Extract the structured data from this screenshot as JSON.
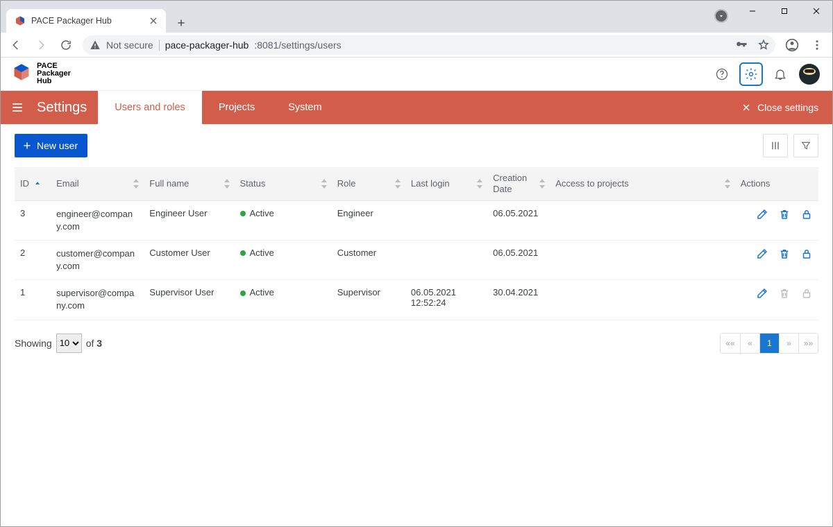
{
  "browser": {
    "tab_title": "PACE Packager Hub",
    "not_secure_label": "Not secure",
    "url_host": "pace-packager-hub",
    "url_port_path": ":8081/settings/users"
  },
  "app": {
    "logo_lines": [
      "PACE",
      "Packager",
      "Hub"
    ]
  },
  "settings_bar": {
    "title": "Settings",
    "tabs": [
      {
        "label": "Users and roles",
        "active": true
      },
      {
        "label": "Projects",
        "active": false
      },
      {
        "label": "System",
        "active": false
      }
    ],
    "close_label": "Close settings"
  },
  "toolbar": {
    "new_user_label": "New user"
  },
  "table": {
    "columns": {
      "id": "ID",
      "email": "Email",
      "full_name": "Full name",
      "status": "Status",
      "role": "Role",
      "last_login": "Last login",
      "creation_date": "Creation Date",
      "access": "Access to projects",
      "actions": "Actions"
    },
    "rows": [
      {
        "id": "3",
        "email": "engineer@company.com",
        "full_name": "Engineer User",
        "status": "Active",
        "role": "Engineer",
        "last_login": "",
        "created": "06.05.2021",
        "access": "",
        "actions_disabled": false
      },
      {
        "id": "2",
        "email": "customer@company.com",
        "full_name": "Customer User",
        "status": "Active",
        "role": "Customer",
        "last_login": "",
        "created": "06.05.2021",
        "access": "",
        "actions_disabled": false
      },
      {
        "id": "1",
        "email": "supervisor@company.com",
        "full_name": "Supervisor User",
        "status": "Active",
        "role": "Supervisor",
        "last_login": "06.05.2021 12:52:24",
        "created": "30.04.2021",
        "access": "",
        "actions_disabled": true
      }
    ]
  },
  "pagination": {
    "showing_label": "Showing",
    "page_size": "10",
    "of_label": "of",
    "total": "3",
    "buttons": {
      "first": "««",
      "prev": "«",
      "current": "1",
      "next": "»",
      "last": "»»"
    }
  }
}
